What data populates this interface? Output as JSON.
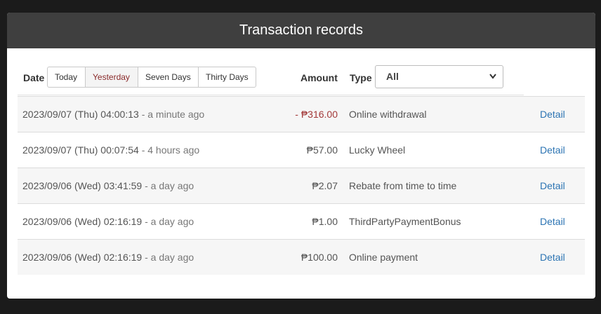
{
  "header": {
    "title": "Transaction records"
  },
  "filters": {
    "date_label": "Date",
    "amount_label": "Amount",
    "type_label": "Type",
    "buttons": [
      {
        "label": "Today"
      },
      {
        "label": "Yesterday",
        "active": true
      },
      {
        "label": "Seven Days"
      },
      {
        "label": "Thirty Days"
      }
    ],
    "type_select": {
      "selected": "All"
    }
  },
  "transactions": [
    {
      "date": "2023/09/07 (Thu) 04:00:13",
      "ago": "- a minute ago",
      "amount": "- ₱316.00",
      "negative": true,
      "type": "Online withdrawal",
      "action": "Detail"
    },
    {
      "date": "2023/09/07 (Thu) 00:07:54",
      "ago": "- 4 hours ago",
      "amount": "₱57.00",
      "negative": false,
      "type": "Lucky Wheel",
      "action": "Detail"
    },
    {
      "date": "2023/09/06 (Wed) 03:41:59",
      "ago": "- a day ago",
      "amount": "₱2.07",
      "negative": false,
      "type": "Rebate from time to time",
      "action": "Detail"
    },
    {
      "date": "2023/09/06 (Wed) 02:16:19",
      "ago": "- a day ago",
      "amount": "₱1.00",
      "negative": false,
      "type": "ThirdPartyPaymentBonus",
      "action": "Detail"
    },
    {
      "date": "2023/09/06 (Wed) 02:16:19",
      "ago": "- a day ago",
      "amount": "₱100.00",
      "negative": false,
      "type": "Online payment",
      "action": "Detail"
    }
  ],
  "colors": {
    "header_bg": "#3f3f3f",
    "negative_amount": "#a33a3a",
    "link": "#2c74b3",
    "active_button_text": "#8a2b2b"
  }
}
